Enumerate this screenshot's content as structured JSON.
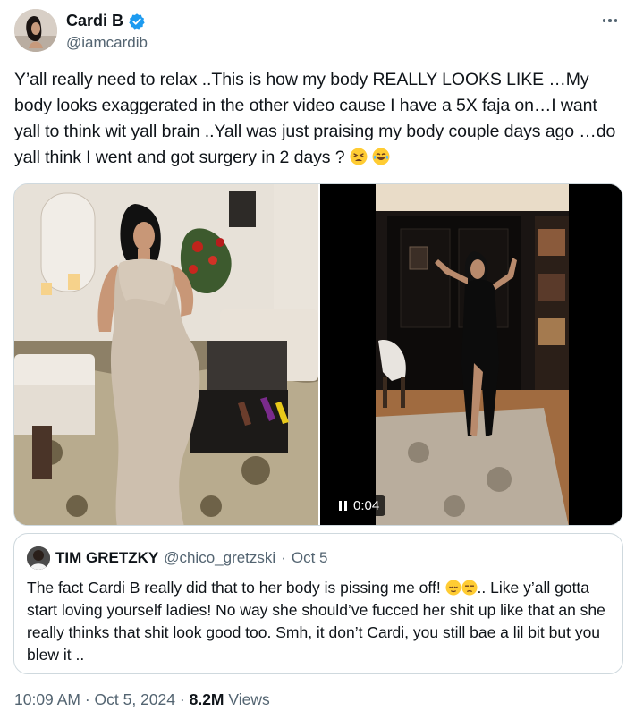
{
  "author": {
    "name": "Cardi B",
    "handle": "@iamcardib",
    "verified_color": "#1d9bf0"
  },
  "tweet": {
    "text": "Y’all really need to relax ..This is how my body REALLY LOOKS LIKE …My body looks exaggerated in the other video cause I have a 5X faja on…I want yall to think wit yall brain ..Yall was  just praising my body couple days ago …do yall think I went and got surgery in 2 days ?",
    "emojis": [
      "tired-face-emoji",
      "tears-of-joy-emoji"
    ]
  },
  "media": {
    "video_time": "0:04"
  },
  "quote": {
    "name": "TIM GRETZKY",
    "handle": "@chico_gretzski",
    "date": "Oct 5",
    "text_before_emoji": "The fact Cardi B really did that to her body is pissing me off! ",
    "text_after_emoji": ".. Like y’all gotta start loving yourself ladies! No way she should’ve fucced her shit up like that an she really thinks that shit look good too. Smh, it don’t Cardi, you still bae a lil bit but you blew it .."
  },
  "meta": {
    "time": "10:09 AM",
    "date": "Oct 5, 2024",
    "views_count": "8.2M",
    "views_label": "Views"
  }
}
